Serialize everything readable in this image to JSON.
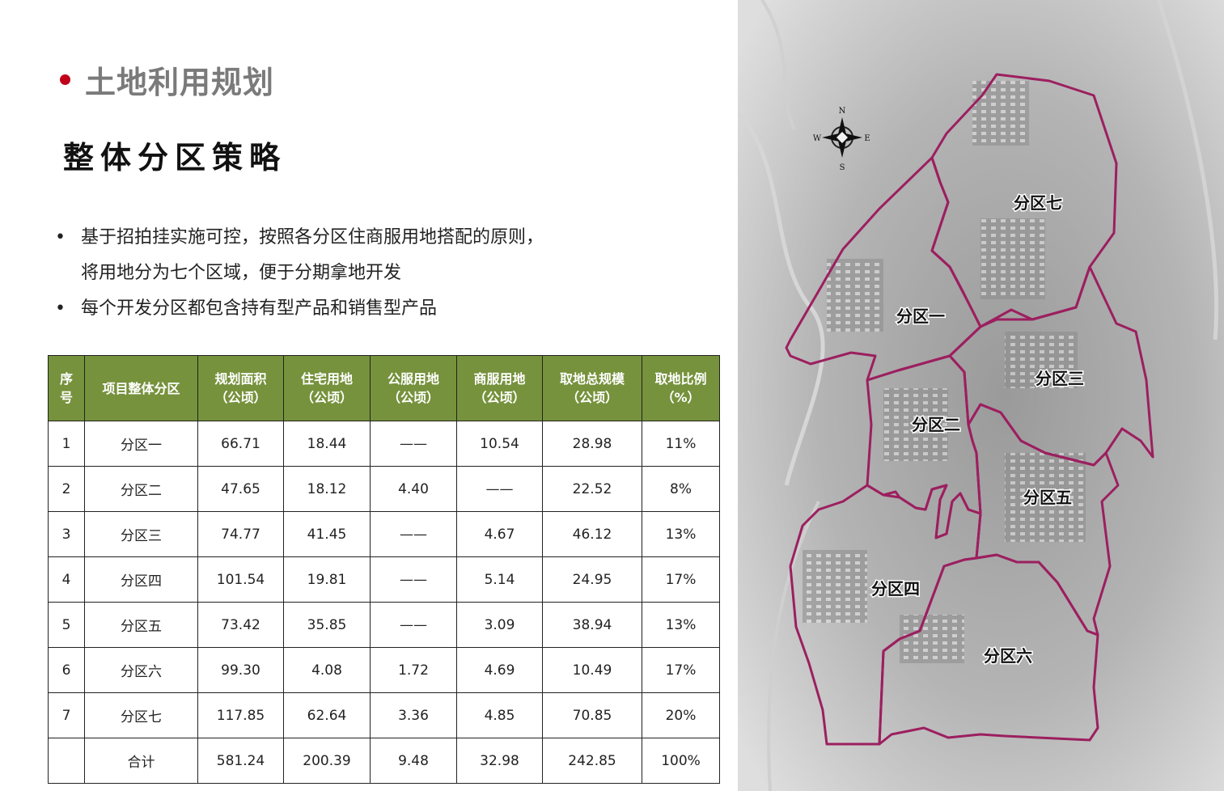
{
  "header": {
    "title": "土地利用规划",
    "subtitle": "整体分区策略",
    "accent_color": "#c0001a"
  },
  "bullets": [
    {
      "mark": "•",
      "lines": [
        "基于招拍挂实施可控，按照各分区住商服用地搭配的原则，",
        "将用地分为七个区域，便于分期拿地开发"
      ]
    },
    {
      "mark": "•",
      "lines": [
        "每个开发分区都包含持有型产品和销售型产品"
      ]
    }
  ],
  "table": {
    "header_color": "#76923c",
    "columns": [
      [
        "序",
        "号"
      ],
      [
        "项目整体分区"
      ],
      [
        "规划面积",
        "（公顷）"
      ],
      [
        "住宅用地",
        "（公顷）"
      ],
      [
        "公服用地",
        "（公顷）"
      ],
      [
        "商服用地",
        "（公顷）"
      ],
      [
        "取地总规模",
        "（公顷）"
      ],
      [
        "取地比例",
        "（%）"
      ]
    ],
    "rows": [
      [
        "1",
        "分区一",
        "66.71",
        "18.44",
        "——",
        "10.54",
        "28.98",
        "11%"
      ],
      [
        "2",
        "分区二",
        "47.65",
        "18.12",
        "4.40",
        "——",
        "22.52",
        "8%"
      ],
      [
        "3",
        "分区三",
        "74.77",
        "41.45",
        "——",
        "4.67",
        "46.12",
        "13%"
      ],
      [
        "4",
        "分区四",
        "101.54",
        "19.81",
        "——",
        "5.14",
        "24.95",
        "17%"
      ],
      [
        "5",
        "分区五",
        "73.42",
        "35.85",
        "——",
        "3.09",
        "38.94",
        "13%"
      ],
      [
        "6",
        "分区六",
        "99.30",
        "4.08",
        "1.72",
        "4.69",
        "10.49",
        "17%"
      ],
      [
        "7",
        "分区七",
        "117.85",
        "62.64",
        "3.36",
        "4.85",
        "70.85",
        "20%"
      ],
      [
        "",
        "合计",
        "581.24",
        "200.39",
        "9.48",
        "32.98",
        "242.85",
        "100%"
      ]
    ]
  },
  "map": {
    "boundary_color": "#9c1f5f",
    "compass": {
      "n": "N",
      "s": "S",
      "e": "E",
      "w": "W"
    },
    "zones": {
      "z1": "分区一",
      "z2": "分区二",
      "z3": "分区三",
      "z4": "分区四",
      "z5": "分区五",
      "z6": "分区六",
      "z7": "分区七"
    }
  }
}
